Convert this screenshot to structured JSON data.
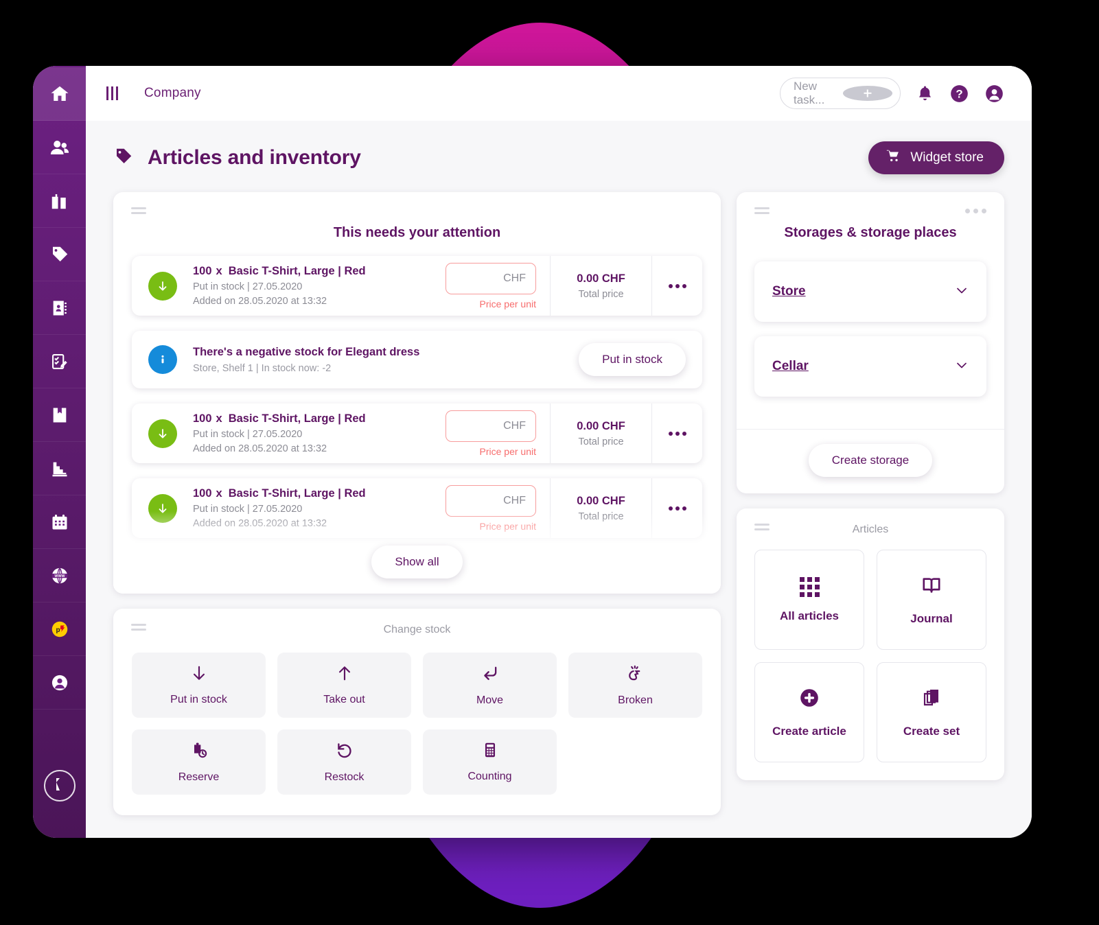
{
  "theme": {
    "brand_purple": "#5E1463",
    "sidebar_purple": "#6C2082",
    "accent_green": "#79BD14",
    "accent_blue": "#158BDA",
    "alert_red": "#F76C6C",
    "circle_top": "#CE1699",
    "circle_bottom": "#6D1FC0"
  },
  "topbar": {
    "menu_icon": "hamburger-icon",
    "company_label": "Company",
    "new_task_placeholder": "New task...",
    "add_icon": "plus-circle-icon",
    "bell_icon": "bell-icon",
    "help_icon": "question-circle-icon",
    "avatar_icon": "user-avatar-icon"
  },
  "page": {
    "icon": "tag-icon",
    "title": "Articles and inventory",
    "widget_store_label": "Widget store",
    "widget_store_icon": "shopping-cart-icon"
  },
  "sidebar": {
    "items": [
      {
        "name": "home",
        "icon": "home-icon",
        "active": true
      },
      {
        "name": "contacts",
        "icon": "people-icon",
        "active": false
      },
      {
        "name": "companies",
        "icon": "buildings-icon",
        "active": false
      },
      {
        "name": "articles",
        "icon": "tag-icon",
        "active": false
      },
      {
        "name": "addressbook",
        "icon": "address-book-icon",
        "active": false
      },
      {
        "name": "tasks",
        "icon": "checklist-edit-icon",
        "active": false
      },
      {
        "name": "documents",
        "icon": "book-bookmark-icon",
        "active": false
      },
      {
        "name": "reports",
        "icon": "stairs-icon",
        "active": false
      },
      {
        "name": "calendar",
        "icon": "calendar-icon",
        "active": false
      },
      {
        "name": "website",
        "icon": "www-globe-icon",
        "active": false
      },
      {
        "name": "post",
        "icon": "post-logo-icon",
        "active": false
      },
      {
        "name": "profile",
        "icon": "user-circle-icon",
        "active": false
      }
    ],
    "logo_label": "K",
    "logo_icon": "k-logo-icon"
  },
  "attention_widget": {
    "title": "This needs your attention",
    "drag_handle_icon": "drag-handle-icon",
    "show_all_label": "Show all",
    "rows": [
      {
        "type": "stock",
        "badge_icon": "arrow-down-icon",
        "qty": "100",
        "multiplier": "x",
        "article": "Basic T-Shirt, Large | Red",
        "sub1": "Put in stock | 27.05.2020",
        "sub2": "Added on 28.05.2020 at 13:32",
        "price_value": "",
        "price_currency": "CHF",
        "price_label": "Price per unit",
        "total_amount": "0.00 CHF",
        "total_label": "Total price",
        "more_icon": "more-horizontal-icon"
      },
      {
        "type": "message",
        "badge_icon": "info-icon",
        "message_title": "There's a negative stock for Elegant dress",
        "message_sub": "Store, Shelf 1 | In stock now: -2",
        "action_label": "Put in stock"
      },
      {
        "type": "stock",
        "badge_icon": "arrow-down-icon",
        "qty": "100",
        "multiplier": "x",
        "article": "Basic T-Shirt, Large | Red",
        "sub1": "Put in stock | 27.05.2020",
        "sub2": "Added on 28.05.2020 at 13:32",
        "price_value": "",
        "price_currency": "CHF",
        "price_label": "Price per unit",
        "total_amount": "0.00 CHF",
        "total_label": "Total price",
        "more_icon": "more-horizontal-icon"
      },
      {
        "type": "stock",
        "badge_icon": "arrow-down-icon",
        "qty": "100",
        "multiplier": "x",
        "article": "Basic T-Shirt, Large | Red",
        "sub1": "Put in stock | 27.05.2020",
        "sub2": "Added on 28.05.2020 at 13:32",
        "price_value": "",
        "price_currency": "CHF",
        "price_label": "Price per unit",
        "total_amount": "0.00 CHF",
        "total_label": "Total price",
        "more_icon": "more-horizontal-icon"
      }
    ]
  },
  "change_stock_widget": {
    "title": "Change stock",
    "drag_handle_icon": "drag-handle-icon",
    "tiles": [
      {
        "label": "Put in stock",
        "icon": "arrow-down-icon"
      },
      {
        "label": "Take out",
        "icon": "arrow-up-icon"
      },
      {
        "label": "Move",
        "icon": "arrow-return-icon"
      },
      {
        "label": "Broken",
        "icon": "broken-item-icon"
      },
      {
        "label": "Reserve",
        "icon": "reserve-clock-icon"
      },
      {
        "label": "Restock",
        "icon": "restock-refresh-icon"
      },
      {
        "label": "Counting",
        "icon": "calculator-icon"
      }
    ]
  },
  "storages_widget": {
    "title": "Storages & storage places",
    "drag_handle_icon": "drag-handle-icon",
    "more_icon": "more-horizontal-icon",
    "items": [
      {
        "label": "Store",
        "chevron": "chevron-down-icon"
      },
      {
        "label": "Cellar",
        "chevron": "chevron-down-icon"
      }
    ],
    "create_label": "Create storage"
  },
  "articles_widget": {
    "title": "Articles",
    "drag_handle_icon": "drag-handle-icon",
    "tiles": [
      {
        "label": "All articles",
        "icon": "grid-dots-icon"
      },
      {
        "label": "Journal",
        "icon": "open-book-icon"
      },
      {
        "label": "Create article",
        "icon": "plus-circle-filled-icon"
      },
      {
        "label": "Create set",
        "icon": "copy-stack-icon"
      }
    ]
  }
}
